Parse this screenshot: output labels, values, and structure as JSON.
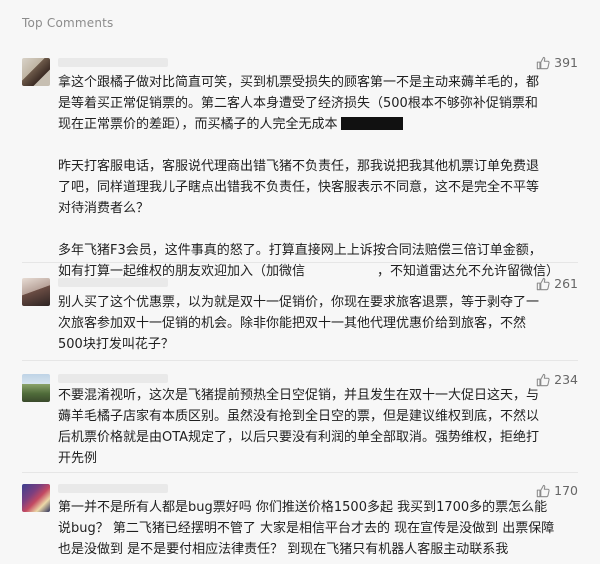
{
  "section": {
    "title": "Top Comments"
  },
  "colors": {
    "like_icon": "#8a8a8a",
    "text": "#1f1f1f",
    "muted": "#8c8c8c"
  },
  "comments": [
    {
      "likes": "391",
      "p1a": "拿这个跟橘子做对比简直可笑，买到机票受损失的顾客第一不是主动来薅羊毛的，都",
      "p1b": "是等着买正常促销票的。第二客人本身遭受了经济损失（500根本不够弥补促销票和",
      "p1c": "现在正常票价的差距），而买橘子的人完全无成本",
      "p2a": "昨天打客服电话，客服说代理商出错飞猪不负责任，那我说把我其他机票订单免费退",
      "p2b": "了吧，同样道理我儿子瞎点出错我不负责任，快客服表示不同意，这不是完全不平等",
      "p2c": "对待消费者么？",
      "p3a": "多年飞猪F3会员，这件事真的怒了。打算直接网上上诉按合同法赔偿三倍订单金额，",
      "p3b_pre": "如有打算一起维权的朋友欢迎加入（加微信",
      "p3b_post": "，不知道雷达允不允许留微信）"
    },
    {
      "likes": "261",
      "l1": "别人买了这个优惠票，以为就是双十一促销价，你现在要求旅客退票，等于剥夺了一",
      "l2": "次旅客参加双十一促销的机会。除非你能把双十一其他代理优惠价给到旅客，不然",
      "l3": "500块打发叫花子？"
    },
    {
      "likes": "234",
      "l1": "不要混淆视听，这次是飞猪提前预热全日空促销，并且发生在双十一大促日这天，与",
      "l2": "薅羊毛橘子店家有本质区别。虽然没有抢到全日空的票，但是建议维权到底，不然以",
      "l3": "后机票价格就是由OTA规定了，以后只要没有利润的单全部取消。强势维权，拒绝打",
      "l4": "开先例"
    },
    {
      "likes": "170",
      "l1": "第一并不是所有人都是bug票好吗 你们推送价格1500多起 我买到1700多的票怎么能",
      "l2": "说bug？ 第二飞猪已经摆明不管了 大家是相信平台才去的 现在宣传是没做到 出票保障",
      "l3": "也是没做到 是不是要付相应法律责任？ 到现在飞猪只有机器人客服主动联系我"
    }
  ]
}
